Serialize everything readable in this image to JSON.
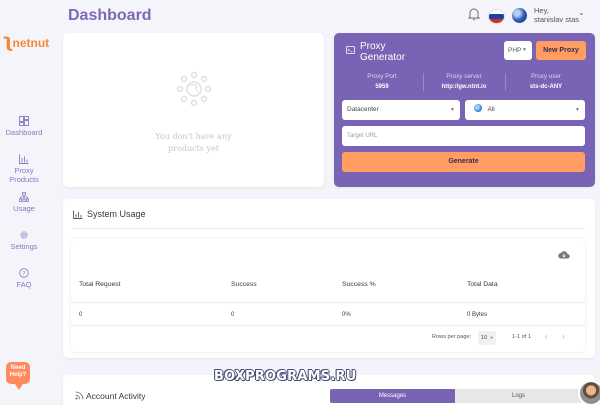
{
  "sidebar": {
    "logo_text": "netnut",
    "items": [
      {
        "label": "Dashboard",
        "icon": "dashboard-icon"
      },
      {
        "label": "Proxy Products",
        "icon": "bar-chart-icon"
      },
      {
        "label": "Usage",
        "icon": "hierarchy-icon"
      },
      {
        "label": "Settings",
        "icon": "gear-icon"
      },
      {
        "label": "FAQ",
        "icon": "question-icon"
      }
    ],
    "help_label": "Need Help?"
  },
  "header": {
    "title": "Dashboard",
    "greeting": "Hey,",
    "username": "stanislav stas",
    "language": "ru"
  },
  "products": {
    "empty_message": "You don't have any products yet"
  },
  "generator": {
    "title": "Proxy Generator",
    "language_select": "PHP",
    "new_proxy_label": "New Proxy",
    "info": [
      {
        "label": "Proxy Port",
        "value": "5959"
      },
      {
        "label": "Proxy server",
        "value": "http://gw.ntnt.io"
      },
      {
        "label": "Proxy user",
        "value": "sts-dc-ANY"
      }
    ],
    "type_select": "Datacenter",
    "country_select": "All",
    "target_placeholder": "Target URL",
    "generate_label": "Generate",
    "accent_color": "#7863b4",
    "button_color": "#ff9d62"
  },
  "usage": {
    "title": "System Usage",
    "columns": [
      "Total Request",
      "Success",
      "Success %",
      "Total Data"
    ],
    "rows": [
      [
        "0",
        "0",
        "0%",
        "0 Bytes"
      ]
    ],
    "rows_per_page_label": "Rows per page:",
    "rows_per_page": "10",
    "range": "1-1 of 1"
  },
  "activity": {
    "title": "Account Activity",
    "tabs": [
      "Messages",
      "Logs"
    ]
  },
  "watermark": "BOXPROGRAMS.RU"
}
